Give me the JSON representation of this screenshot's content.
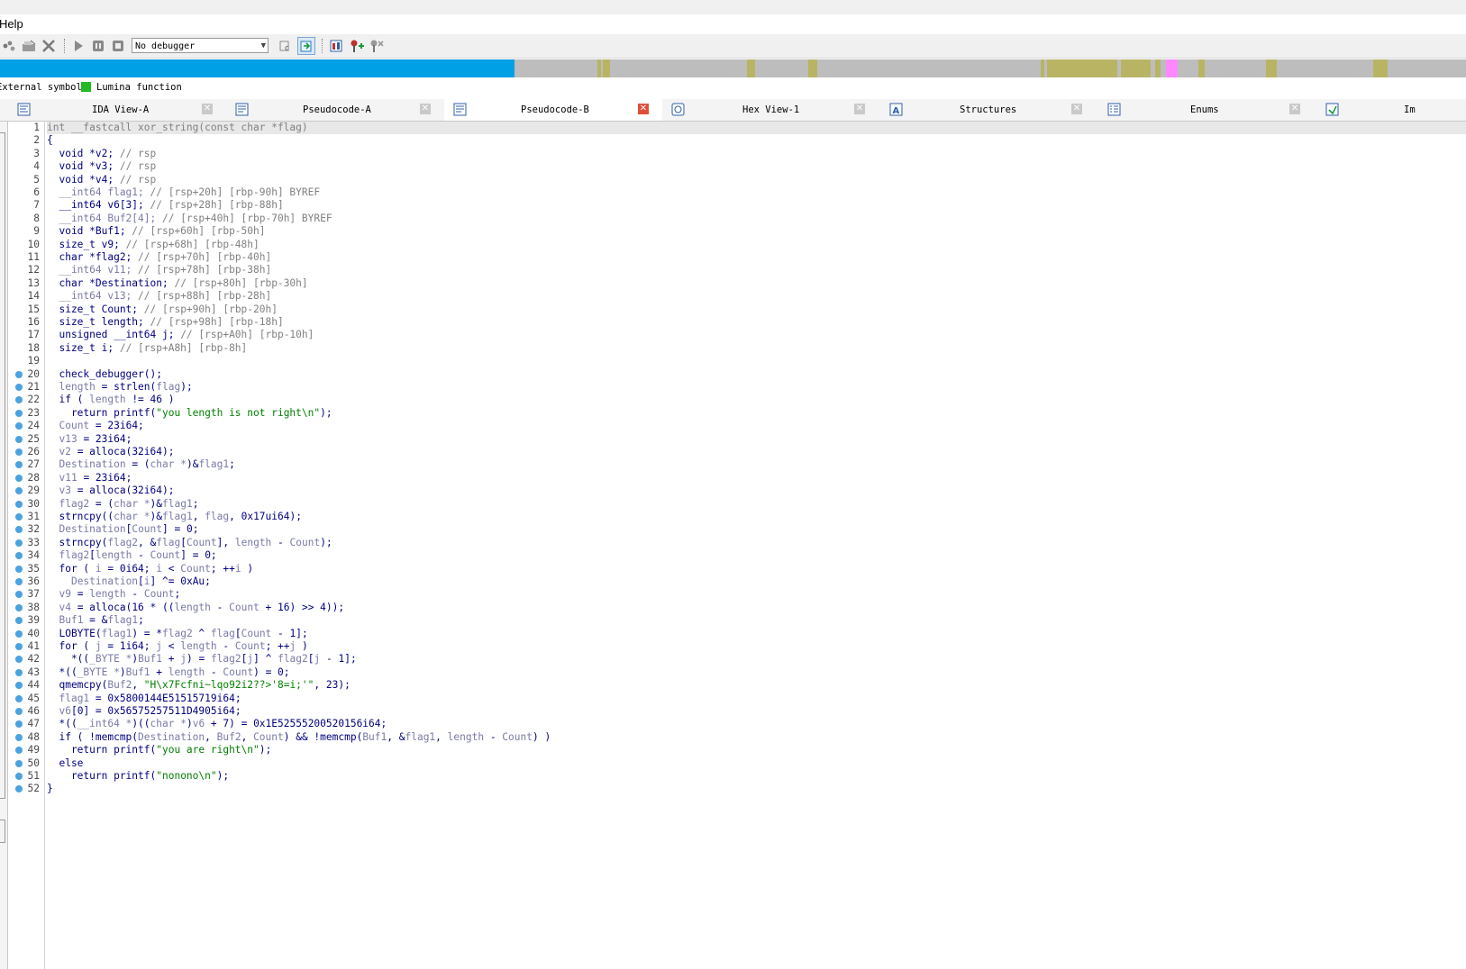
{
  "menu": {
    "help_label": "Help"
  },
  "toolbar": {
    "debugger_selected": "No debugger",
    "icons": [
      "dots-icon",
      "open-icon",
      "close-icon",
      "play-icon",
      "pause-icon",
      "stop-icon",
      "dropdown-arrow-icon",
      "auto-icon",
      "refresh-icon",
      "graph-icon",
      "add-icon",
      "remove-icon"
    ]
  },
  "navbar": {
    "colors": {
      "library": "#00a0e6",
      "unexplored": "#bdbdbd",
      "external": "#b8b464",
      "lumina": "#ff88ff"
    }
  },
  "legend": {
    "items": [
      {
        "label": "External symbol",
        "color": "#ffffff"
      },
      {
        "label": "Lumina function",
        "color": "#22bb22"
      }
    ]
  },
  "tabs": [
    {
      "label": "IDA View-A",
      "active": false,
      "icon": "ida-view-icon"
    },
    {
      "label": "Pseudocode-A",
      "active": false,
      "icon": "pseudocode-icon"
    },
    {
      "label": "Pseudocode-B",
      "active": true,
      "icon": "pseudocode-icon"
    },
    {
      "label": "Hex View-1",
      "active": false,
      "icon": "hex-icon"
    },
    {
      "label": "Structures",
      "active": false,
      "icon": "structures-icon"
    },
    {
      "label": "Enums",
      "active": false,
      "icon": "enums-icon"
    },
    {
      "label": "Im",
      "active": false,
      "icon": "imports-icon"
    }
  ],
  "code": {
    "breakpoint_lines_from": 20,
    "lines": [
      [
        {
          "t": "int __fastcall xor_string(const char *flag)"
        }
      ],
      [
        {
          "t": "{"
        }
      ],
      [
        {
          "t": "  void *v2; "
        },
        {
          "t": "// rsp",
          "c": "cm"
        }
      ],
      [
        {
          "t": "  void *v3; "
        },
        {
          "t": "// rsp",
          "c": "cm"
        }
      ],
      [
        {
          "t": "  void *v4; "
        },
        {
          "t": "// rsp",
          "c": "cm"
        }
      ],
      [
        {
          "t": "  __int64 flag1; ",
          "c": "vr"
        },
        {
          "t": "// [rsp+20h] [rbp-90h] BYREF",
          "c": "cm"
        }
      ],
      [
        {
          "t": "  __int64 v6[3]; "
        },
        {
          "t": "// [rsp+28h] [rbp-88h]",
          "c": "cm"
        }
      ],
      [
        {
          "t": "  __int64 Buf2[4]; ",
          "c": "vr"
        },
        {
          "t": "// [rsp+40h] [rbp-70h] BYREF",
          "c": "cm"
        }
      ],
      [
        {
          "t": "  void *Buf1; "
        },
        {
          "t": "// [rsp+60h] [rbp-50h]",
          "c": "cm"
        }
      ],
      [
        {
          "t": "  size_t v9; "
        },
        {
          "t": "// [rsp+68h] [rbp-48h]",
          "c": "cm"
        }
      ],
      [
        {
          "t": "  char *flag2; "
        },
        {
          "t": "// [rsp+70h] [rbp-40h]",
          "c": "cm"
        }
      ],
      [
        {
          "t": "  __int64 v11; ",
          "c": "vr"
        },
        {
          "t": "// [rsp+78h] [rbp-38h]",
          "c": "cm"
        }
      ],
      [
        {
          "t": "  char *Destination; "
        },
        {
          "t": "// [rsp+80h] [rbp-30h]",
          "c": "cm"
        }
      ],
      [
        {
          "t": "  __int64 v13; ",
          "c": "vr"
        },
        {
          "t": "// [rsp+88h] [rbp-28h]",
          "c": "cm"
        }
      ],
      [
        {
          "t": "  size_t Count; "
        },
        {
          "t": "// [rsp+90h] [rbp-20h]",
          "c": "cm"
        }
      ],
      [
        {
          "t": "  size_t length; "
        },
        {
          "t": "// [rsp+98h] [rbp-18h]",
          "c": "cm"
        }
      ],
      [
        {
          "t": "  unsigned __int64 j; "
        },
        {
          "t": "// [rsp+A0h] [rbp-10h]",
          "c": "cm"
        }
      ],
      [
        {
          "t": "  size_t i; "
        },
        {
          "t": "// [rsp+A8h] [rbp-8h]",
          "c": "cm"
        }
      ],
      [
        {
          "t": ""
        }
      ],
      [
        {
          "t": "  check_debugger();"
        }
      ],
      [
        {
          "t": "  "
        },
        {
          "t": "length",
          "c": "vr"
        },
        {
          "t": " = strlen("
        },
        {
          "t": "flag",
          "c": "vr"
        },
        {
          "t": ");"
        }
      ],
      [
        {
          "t": "  if ( "
        },
        {
          "t": "length",
          "c": "vr"
        },
        {
          "t": " != 46 )"
        }
      ],
      [
        {
          "t": "    return printf("
        },
        {
          "t": "\"you length is not right\\n\"",
          "c": "st"
        },
        {
          "t": ");"
        }
      ],
      [
        {
          "t": "  "
        },
        {
          "t": "Count",
          "c": "vr"
        },
        {
          "t": " = 23i64;"
        }
      ],
      [
        {
          "t": "  "
        },
        {
          "t": "v13",
          "c": "vr"
        },
        {
          "t": " = 23i64;"
        }
      ],
      [
        {
          "t": "  "
        },
        {
          "t": "v2",
          "c": "vr"
        },
        {
          "t": " = alloca(32i64);"
        }
      ],
      [
        {
          "t": "  "
        },
        {
          "t": "Destination",
          "c": "vr"
        },
        {
          "t": " = ("
        },
        {
          "t": "char *",
          "c": "vr"
        },
        {
          "t": ")&"
        },
        {
          "t": "flag1",
          "c": "vr"
        },
        {
          "t": ";"
        }
      ],
      [
        {
          "t": "  "
        },
        {
          "t": "v11",
          "c": "vr"
        },
        {
          "t": " = 23i64;"
        }
      ],
      [
        {
          "t": "  "
        },
        {
          "t": "v3",
          "c": "vr"
        },
        {
          "t": " = alloca(32i64);"
        }
      ],
      [
        {
          "t": "  "
        },
        {
          "t": "flag2",
          "c": "vr"
        },
        {
          "t": " = ("
        },
        {
          "t": "char *",
          "c": "vr"
        },
        {
          "t": ")&"
        },
        {
          "t": "flag1",
          "c": "vr"
        },
        {
          "t": ";"
        }
      ],
      [
        {
          "t": "  strncpy(("
        },
        {
          "t": "char *",
          "c": "vr"
        },
        {
          "t": ")&"
        },
        {
          "t": "flag1",
          "c": "vr"
        },
        {
          "t": ", "
        },
        {
          "t": "flag",
          "c": "vr"
        },
        {
          "t": ", 0x17ui64);"
        }
      ],
      [
        {
          "t": "  "
        },
        {
          "t": "Destination",
          "c": "vr"
        },
        {
          "t": "["
        },
        {
          "t": "Count",
          "c": "vr"
        },
        {
          "t": "] = 0;"
        }
      ],
      [
        {
          "t": "  strncpy("
        },
        {
          "t": "flag2",
          "c": "vr"
        },
        {
          "t": ", &"
        },
        {
          "t": "flag",
          "c": "vr"
        },
        {
          "t": "["
        },
        {
          "t": "Count",
          "c": "vr"
        },
        {
          "t": "], "
        },
        {
          "t": "length",
          "c": "vr"
        },
        {
          "t": " - "
        },
        {
          "t": "Count",
          "c": "vr"
        },
        {
          "t": ");"
        }
      ],
      [
        {
          "t": "  "
        },
        {
          "t": "flag2",
          "c": "vr"
        },
        {
          "t": "["
        },
        {
          "t": "length",
          "c": "vr"
        },
        {
          "t": " - "
        },
        {
          "t": "Count",
          "c": "vr"
        },
        {
          "t": "] = 0;"
        }
      ],
      [
        {
          "t": "  for ( "
        },
        {
          "t": "i",
          "c": "vr"
        },
        {
          "t": " = 0i64; "
        },
        {
          "t": "i",
          "c": "vr"
        },
        {
          "t": " < "
        },
        {
          "t": "Count",
          "c": "vr"
        },
        {
          "t": "; ++"
        },
        {
          "t": "i",
          "c": "vr"
        },
        {
          "t": " )"
        }
      ],
      [
        {
          "t": "    "
        },
        {
          "t": "Destination",
          "c": "vr"
        },
        {
          "t": "["
        },
        {
          "t": "i",
          "c": "vr"
        },
        {
          "t": "] ^= 0xAu;"
        }
      ],
      [
        {
          "t": "  "
        },
        {
          "t": "v9",
          "c": "vr"
        },
        {
          "t": " = "
        },
        {
          "t": "length",
          "c": "vr"
        },
        {
          "t": " - "
        },
        {
          "t": "Count",
          "c": "vr"
        },
        {
          "t": ";"
        }
      ],
      [
        {
          "t": "  "
        },
        {
          "t": "v4",
          "c": "vr"
        },
        {
          "t": " = alloca(16 * (("
        },
        {
          "t": "length",
          "c": "vr"
        },
        {
          "t": " - "
        },
        {
          "t": "Count",
          "c": "vr"
        },
        {
          "t": " + 16) >> 4));"
        }
      ],
      [
        {
          "t": "  "
        },
        {
          "t": "Buf1",
          "c": "vr"
        },
        {
          "t": " = &"
        },
        {
          "t": "flag1",
          "c": "vr"
        },
        {
          "t": ";"
        }
      ],
      [
        {
          "t": "  LOBYTE("
        },
        {
          "t": "flag1",
          "c": "vr"
        },
        {
          "t": ") = *"
        },
        {
          "t": "flag2",
          "c": "vr"
        },
        {
          "t": " ^ "
        },
        {
          "t": "flag",
          "c": "vr"
        },
        {
          "t": "["
        },
        {
          "t": "Count",
          "c": "vr"
        },
        {
          "t": " - 1];"
        }
      ],
      [
        {
          "t": "  for ( "
        },
        {
          "t": "j",
          "c": "vr"
        },
        {
          "t": " = 1i64; "
        },
        {
          "t": "j",
          "c": "vr"
        },
        {
          "t": " < "
        },
        {
          "t": "length",
          "c": "vr"
        },
        {
          "t": " - "
        },
        {
          "t": "Count",
          "c": "vr"
        },
        {
          "t": "; ++"
        },
        {
          "t": "j",
          "c": "vr"
        },
        {
          "t": " )"
        }
      ],
      [
        {
          "t": "    *(("
        },
        {
          "t": "_BYTE *",
          "c": "vr"
        },
        {
          "t": ")"
        },
        {
          "t": "Buf1",
          "c": "vr"
        },
        {
          "t": " + "
        },
        {
          "t": "j",
          "c": "vr"
        },
        {
          "t": ") = "
        },
        {
          "t": "flag2",
          "c": "vr"
        },
        {
          "t": "["
        },
        {
          "t": "j",
          "c": "vr"
        },
        {
          "t": "] ^ "
        },
        {
          "t": "flag2",
          "c": "vr"
        },
        {
          "t": "["
        },
        {
          "t": "j",
          "c": "vr"
        },
        {
          "t": " - 1];"
        }
      ],
      [
        {
          "t": "  *(("
        },
        {
          "t": "_BYTE *",
          "c": "vr"
        },
        {
          "t": ")"
        },
        {
          "t": "Buf1",
          "c": "vr"
        },
        {
          "t": " + "
        },
        {
          "t": "length",
          "c": "vr"
        },
        {
          "t": " - "
        },
        {
          "t": "Count",
          "c": "vr"
        },
        {
          "t": ") = 0;"
        }
      ],
      [
        {
          "t": "  qmemcpy("
        },
        {
          "t": "Buf2",
          "c": "vr"
        },
        {
          "t": ", "
        },
        {
          "t": "\"H\\x7Fcfni~lqo92i2??>'8=i;'\"",
          "c": "st"
        },
        {
          "t": ", 23);"
        }
      ],
      [
        {
          "t": "  "
        },
        {
          "t": "flag1",
          "c": "vr"
        },
        {
          "t": " = 0x5800144E51515719i64;"
        }
      ],
      [
        {
          "t": "  "
        },
        {
          "t": "v6",
          "c": "vr"
        },
        {
          "t": "[0] = 0x56575257511D4905i64;"
        }
      ],
      [
        {
          "t": "  *(("
        },
        {
          "t": "__int64 *",
          "c": "vr"
        },
        {
          "t": ")(("
        },
        {
          "t": "char *",
          "c": "vr"
        },
        {
          "t": ")"
        },
        {
          "t": "v6",
          "c": "vr"
        },
        {
          "t": " + 7) = 0x1E52555200520156i64;"
        }
      ],
      [
        {
          "t": "  if ( !memcmp("
        },
        {
          "t": "Destination",
          "c": "vr"
        },
        {
          "t": ", "
        },
        {
          "t": "Buf2",
          "c": "vr"
        },
        {
          "t": ", "
        },
        {
          "t": "Count",
          "c": "vr"
        },
        {
          "t": ") && !memcmp("
        },
        {
          "t": "Buf1",
          "c": "vr"
        },
        {
          "t": ", &"
        },
        {
          "t": "flag1",
          "c": "vr"
        },
        {
          "t": ", "
        },
        {
          "t": "length",
          "c": "vr"
        },
        {
          "t": " - "
        },
        {
          "t": "Count",
          "c": "vr"
        },
        {
          "t": ") )"
        }
      ],
      [
        {
          "t": "    return printf("
        },
        {
          "t": "\"you are right\\n\"",
          "c": "st"
        },
        {
          "t": ");"
        }
      ],
      [
        {
          "t": "  else"
        }
      ],
      [
        {
          "t": "    return printf("
        },
        {
          "t": "\"nonono\\n\"",
          "c": "st"
        },
        {
          "t": ");"
        }
      ],
      [
        {
          "t": "}"
        }
      ]
    ]
  }
}
